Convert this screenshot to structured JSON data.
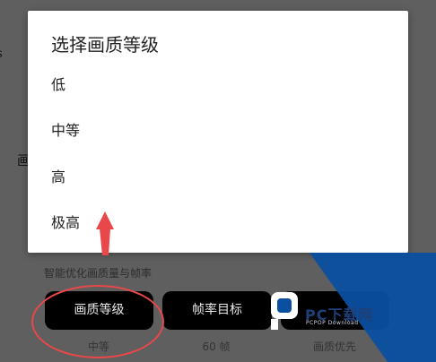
{
  "background": {
    "edge_chars": [
      "s",
      "画"
    ]
  },
  "dialog": {
    "title": "选择画质等级",
    "options": [
      {
        "label": "低"
      },
      {
        "label": "中等"
      },
      {
        "label": "高"
      },
      {
        "label": "极高"
      }
    ]
  },
  "settings": {
    "hint": "智能优化画质量与帧率",
    "buttons": [
      {
        "label": "画质等级",
        "value": "中等"
      },
      {
        "label": "帧率目标",
        "value": "60 帧"
      },
      {
        "label": "",
        "value": "画质优先"
      }
    ]
  },
  "watermark": {
    "text": "PC下载网",
    "sub": "PCPOP Download"
  },
  "colors": {
    "annotation_red": "#e9484a",
    "watermark_blue": "#0b4fa0"
  }
}
